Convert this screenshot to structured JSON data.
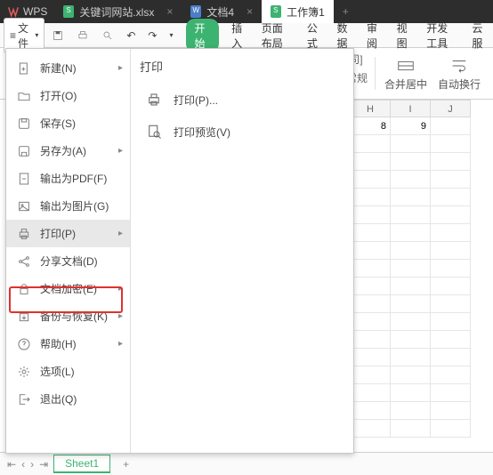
{
  "titlebar": {
    "app_name": "WPS",
    "tabs": [
      {
        "label": "关键词网站.xlsx",
        "type": "sheet"
      },
      {
        "label": "文档4",
        "type": "doc"
      },
      {
        "label": "工作簿1",
        "type": "sheet",
        "active": true
      }
    ],
    "add": "+"
  },
  "toolbar": {
    "file_label": "文件",
    "menus": {
      "start": "开始",
      "insert": "插入",
      "layout": "页面布局",
      "formula": "公式",
      "data": "数据",
      "review": "审阅",
      "view": "视图",
      "dev": "开发工具",
      "cloud": "云服"
    }
  },
  "ribbon": {
    "fmt_row1": "[司]",
    "fmt_row2": "常规",
    "merge": "合并居中",
    "wrap": "自动换行"
  },
  "file_menu": {
    "right_title": "打印",
    "items": {
      "new": "新建(N)",
      "open": "打开(O)",
      "save": "保存(S)",
      "save_as": "另存为(A)",
      "export_pdf": "输出为PDF(F)",
      "export_img": "输出为图片(G)",
      "print": "打印(P)",
      "share": "分享文档(D)",
      "encrypt": "文档加密(E)",
      "backup": "备份与恢复(K)",
      "help": "帮助(H)",
      "options": "选项(L)",
      "exit": "退出(Q)"
    },
    "sub": {
      "print": "打印(P)...",
      "preview": "打印预览(V)"
    }
  },
  "sheet": {
    "cols": [
      "H",
      "I",
      "J"
    ],
    "data": {
      "H": "8",
      "I": "9"
    },
    "tab": "Sheet1",
    "add": "+"
  }
}
